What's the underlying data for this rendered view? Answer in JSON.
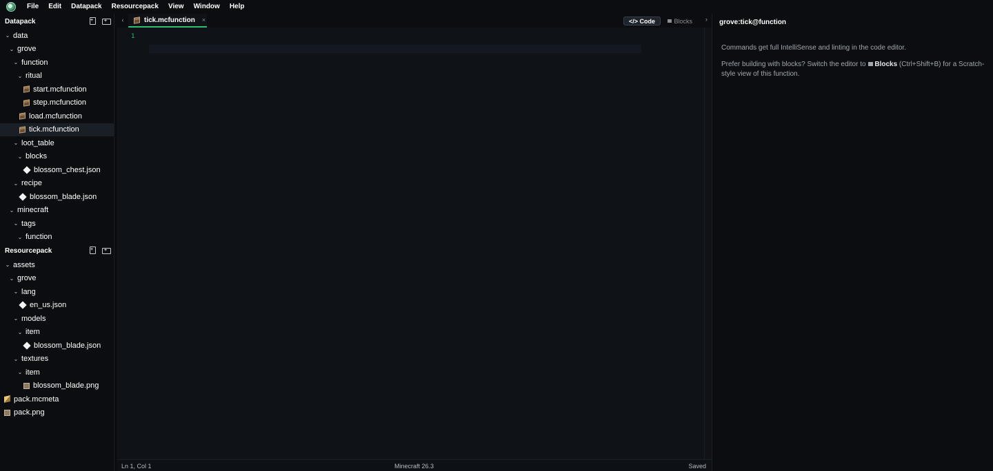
{
  "menubar": {
    "items": [
      "File",
      "Edit",
      "Datapack",
      "Resourcepack",
      "View",
      "Window",
      "Help"
    ]
  },
  "sidebar": {
    "datapack": {
      "title": "Datapack",
      "items": [
        {
          "label": "data",
          "depth": 0,
          "kind": "folder"
        },
        {
          "label": "grove",
          "depth": 1,
          "kind": "folder"
        },
        {
          "label": "function",
          "depth": 2,
          "kind": "folder"
        },
        {
          "label": "ritual",
          "depth": 3,
          "kind": "folder"
        },
        {
          "label": "start.mcfunction",
          "depth": 4,
          "kind": "mcfunction"
        },
        {
          "label": "step.mcfunction",
          "depth": 4,
          "kind": "mcfunction"
        },
        {
          "label": "load.mcfunction",
          "depth": 3,
          "kind": "mcfunction"
        },
        {
          "label": "tick.mcfunction",
          "depth": 3,
          "kind": "mcfunction",
          "selected": true
        },
        {
          "label": "loot_table",
          "depth": 2,
          "kind": "folder"
        },
        {
          "label": "blocks",
          "depth": 3,
          "kind": "folder"
        },
        {
          "label": "blossom_chest.json",
          "depth": 4,
          "kind": "json"
        },
        {
          "label": "recipe",
          "depth": 2,
          "kind": "folder"
        },
        {
          "label": "blossom_blade.json",
          "depth": 3,
          "kind": "json"
        },
        {
          "label": "minecraft",
          "depth": 1,
          "kind": "folder"
        },
        {
          "label": "tags",
          "depth": 2,
          "kind": "folder"
        },
        {
          "label": "function",
          "depth": 3,
          "kind": "folder"
        }
      ]
    },
    "resourcepack": {
      "title": "Resourcepack",
      "items": [
        {
          "label": "assets",
          "depth": 0,
          "kind": "folder"
        },
        {
          "label": "grove",
          "depth": 1,
          "kind": "folder"
        },
        {
          "label": "lang",
          "depth": 2,
          "kind": "folder"
        },
        {
          "label": "en_us.json",
          "depth": 3,
          "kind": "json"
        },
        {
          "label": "models",
          "depth": 2,
          "kind": "folder"
        },
        {
          "label": "item",
          "depth": 3,
          "kind": "folder"
        },
        {
          "label": "blossom_blade.json",
          "depth": 4,
          "kind": "json"
        },
        {
          "label": "textures",
          "depth": 2,
          "kind": "folder"
        },
        {
          "label": "item",
          "depth": 3,
          "kind": "folder"
        },
        {
          "label": "blossom_blade.png",
          "depth": 4,
          "kind": "png"
        },
        {
          "label": "pack.mcmeta",
          "depth": -1,
          "kind": "mcmeta"
        },
        {
          "label": "pack.png",
          "depth": -1,
          "kind": "png"
        }
      ]
    }
  },
  "editor": {
    "tab_label": "tick.mcfunction",
    "tab_close": "×",
    "code_toggle": "</> Code",
    "blocks_toggle": "Blocks",
    "nav_left": "‹",
    "nav_right": "›",
    "line_number": "1"
  },
  "statusbar": {
    "position": "Ln 1, Col 1",
    "version": "Minecraft 26.3",
    "state": "Saved"
  },
  "rightpanel": {
    "title": "grove:tick@function",
    "p1": "Commands get full IntelliSense and linting in the code editor.",
    "p2_before": "Prefer building with blocks? Switch the editor to",
    "p2_bold": "Blocks",
    "p2_after": "(Ctrl+Shift+B) for a Scratch-style view of this function."
  },
  "colors": {
    "accent": "#2fbf71",
    "background": "#0b0d11",
    "editor_bg": "#0f1217"
  }
}
